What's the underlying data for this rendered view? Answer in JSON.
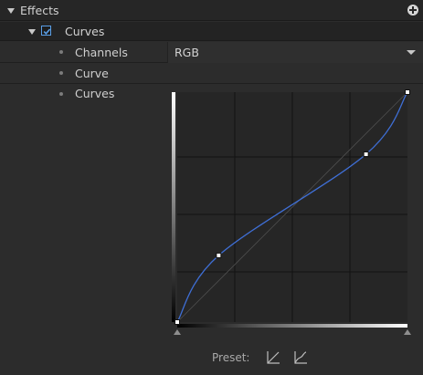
{
  "panel": {
    "title": "Effects"
  },
  "effect": {
    "name": "Curves",
    "enabled": true
  },
  "properties": {
    "channels_label": "Channels",
    "channels_value": "RGB",
    "curve_label": "Curve",
    "curves_label": "Curves"
  },
  "curve_editor": {
    "control_points": [
      [
        0,
        0
      ],
      [
        0.18,
        0.29
      ],
      [
        0.82,
        0.73
      ],
      [
        1,
        1
      ]
    ],
    "grid_divisions": 4,
    "curve_color": "#3f6fd6"
  },
  "preset": {
    "label": "Preset:"
  },
  "colors": {
    "accent": "#5a9fe6",
    "background": "#2c2c2c"
  }
}
